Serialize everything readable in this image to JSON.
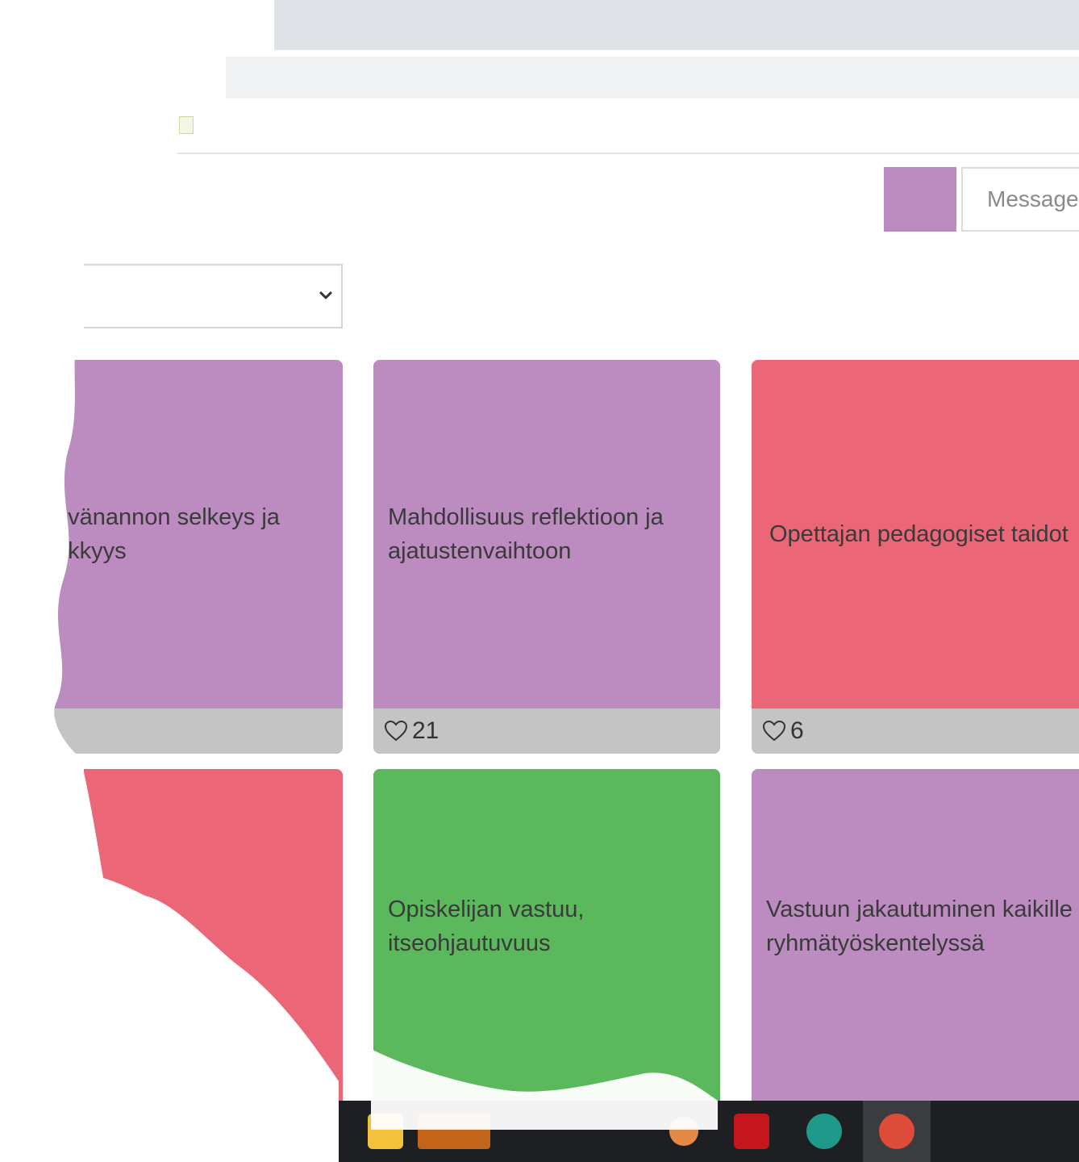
{
  "colors": {
    "purple": "#bc8bbf",
    "red": "#eb6677",
    "green": "#5cb85c",
    "footer_gray": "#c4c4c4",
    "swatch": "#bc8bbf"
  },
  "message": {
    "placeholder": "Message"
  },
  "cards": [
    {
      "text": "ävänannon selkeys ja\nekkyys",
      "color": "purple",
      "likes": ""
    },
    {
      "text": "Mahdollisuus reflektioon ja\najatustenvaihtoon",
      "color": "purple",
      "likes": "21"
    },
    {
      "text": "Opettajan pedagogiset taidot",
      "color": "red",
      "likes": "6"
    },
    {
      "text": "",
      "color": "red",
      "likes": ""
    },
    {
      "text": "Opiskelijan vastuu,\nitseohjautuvuus",
      "color": "green",
      "likes": ""
    },
    {
      "text": "Vastuun jakautuminen kaikille\nryhmätyöskentelyssä",
      "color": "purple",
      "likes": ""
    }
  ],
  "icons": {
    "heart": "heart-outline-icon",
    "chevron": "chevron-down-icon"
  }
}
